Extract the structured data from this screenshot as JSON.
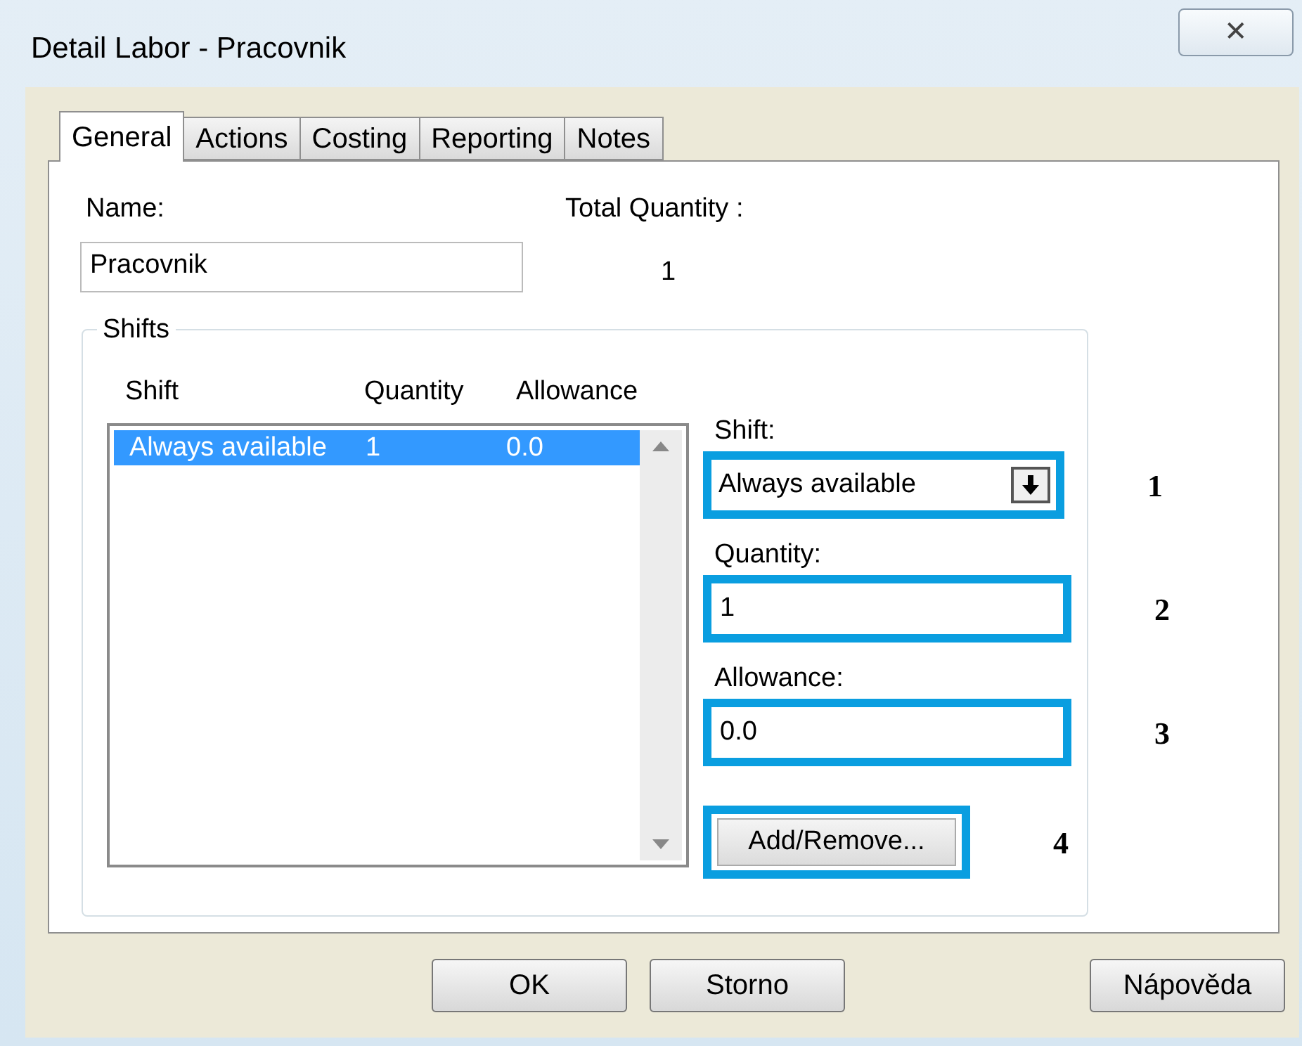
{
  "window": {
    "title": "Detail Labor - Pracovnik",
    "close": "✕"
  },
  "tabs": [
    {
      "label": "General",
      "selected": true
    },
    {
      "label": "Actions",
      "selected": false
    },
    {
      "label": "Costing",
      "selected": false
    },
    {
      "label": "Reporting",
      "selected": false
    },
    {
      "label": "Notes",
      "selected": false
    }
  ],
  "name": {
    "label": "Name:",
    "value": "Pracovnik"
  },
  "total_quantity": {
    "label": "Total Quantity :",
    "value": "1"
  },
  "shifts": {
    "title": "Shifts",
    "columns": [
      "Shift",
      "Quantity",
      "Allowance"
    ],
    "rows": [
      {
        "cells": [
          "Always available",
          "1",
          "0.0"
        ],
        "selected": true
      }
    ],
    "controls": [
      {
        "kind": "dropdown",
        "label": "Shift:",
        "value": "Always available",
        "callout": "1"
      },
      {
        "kind": "text",
        "label": "Quantity:",
        "value": "1",
        "callout": "2"
      },
      {
        "kind": "text",
        "label": "Allowance:",
        "value": "0.0",
        "callout": "3"
      },
      {
        "kind": "button",
        "value": "Add/Remove...",
        "callout": "4"
      }
    ]
  },
  "buttons": [
    "OK",
    "Storno",
    "Nápověda"
  ]
}
